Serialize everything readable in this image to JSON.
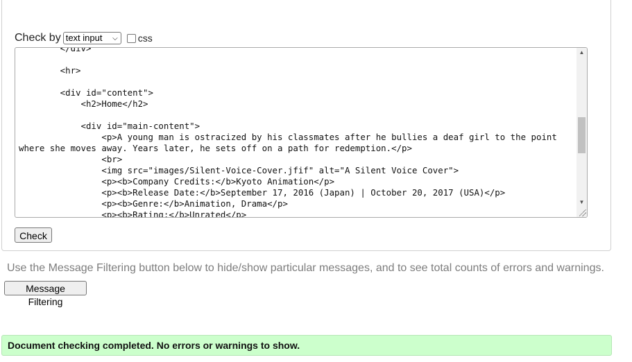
{
  "form": {
    "check_by_label": "Check by",
    "check_by_selected": "text input",
    "css_label": "css",
    "source_lines": [
      "        </div>",
      "",
      "        <hr>",
      "",
      "        <div id=\"content\">",
      "            <h2>Home</h2>",
      "",
      "            <div id=\"main-content\">",
      "                <p>A young man is ostracized by his classmates after he bullies a deaf girl to the point",
      "where she moves away. Years later, he sets off on a path for redemption.</p>",
      "                <br>",
      "                <img src=\"images/Silent-Voice-Cover.jfif\" alt=\"A Silent Voice Cover\">",
      "                <p><b>Company Credits:</b>Kyoto Animation</p>",
      "                <p><b>Release Date:</b>September 17, 2016 (Japan) | October 20, 2017 (USA)</p>",
      "                <p><b>Genre:</b>Animation, Drama</p>",
      "                <p><b>Rating:</b>Unrated</p>"
    ],
    "check_button": "Check"
  },
  "info": {
    "text": "Use the Message Filtering button below to hide/show particular messages, and to see total counts of errors and warnings.",
    "filter_button": "Message Filtering"
  },
  "status": {
    "message": "Document checking completed. No errors or warnings to show.",
    "color": "#ccffcc"
  },
  "icons": {
    "select_chevron": "chevron-down-icon",
    "scroll_up": "triangle-up-icon",
    "scroll_down": "triangle-down-icon"
  }
}
